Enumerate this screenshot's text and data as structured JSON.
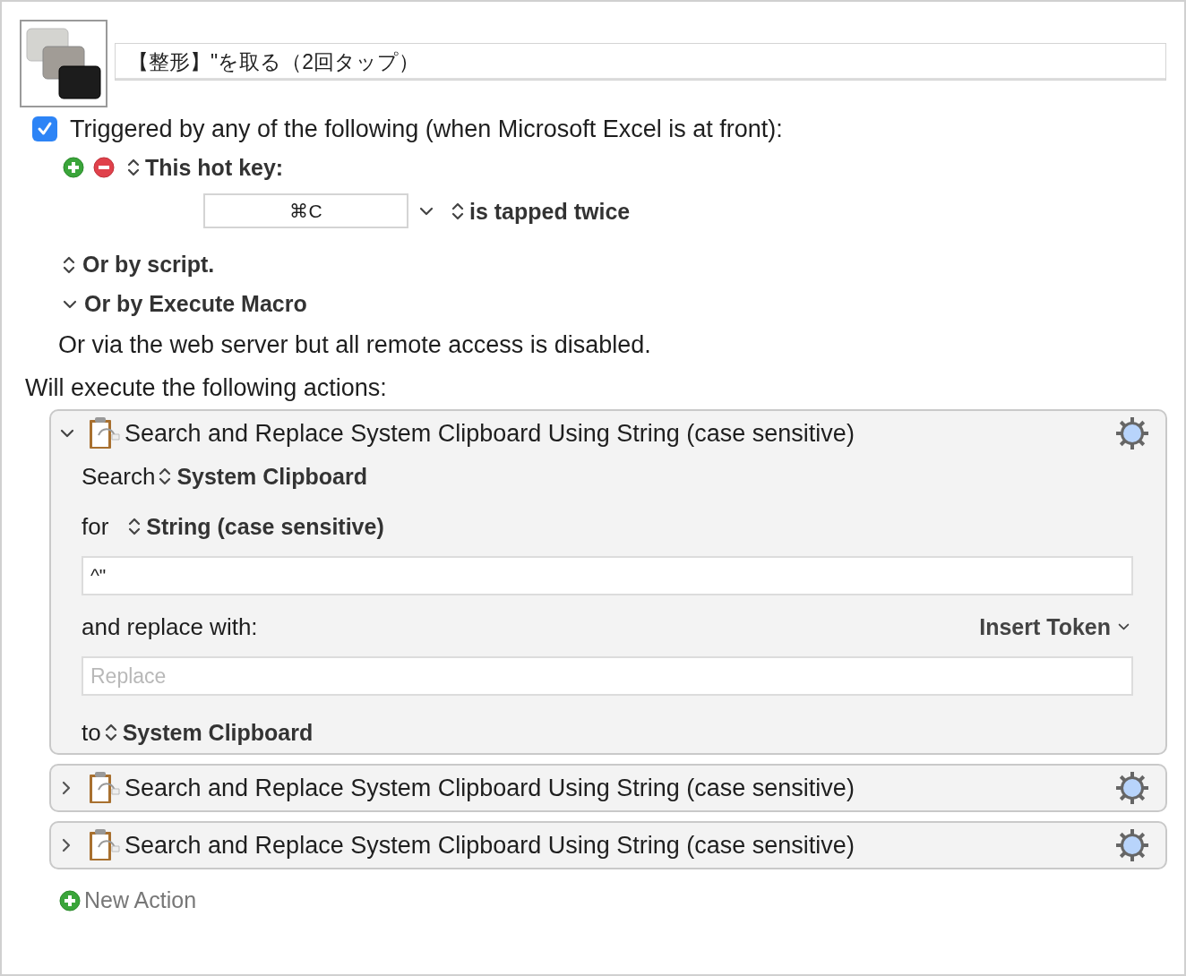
{
  "macro": {
    "name": "【整形】\"を取る（2回タップ）"
  },
  "trigger": {
    "checked": true,
    "label": "Triggered by any of the following (when Microsoft Excel is at front):"
  },
  "hot_key": {
    "label": "This hot key:",
    "key": "⌘C",
    "mode": "is tapped twice"
  },
  "trigger_options": [
    {
      "kind": "popup",
      "label": "Or by script."
    },
    {
      "kind": "disclosure",
      "label": "Or by Execute Macro"
    }
  ],
  "web_server_note": "Or via the web server but all remote access is disabled.",
  "actions_heading": "Will execute the following actions:",
  "actions": [
    {
      "title": "Search and Replace System Clipboard Using String (case sensitive)",
      "expanded": true,
      "search_label": "Search",
      "search_source": "System Clipboard",
      "for_label": "for",
      "match_type": "String (case sensitive)",
      "search_value": "^\"",
      "replace_label": "and replace with:",
      "insert_token": "Insert Token",
      "replace_placeholder": "Replace",
      "to_label": "to",
      "destination": "System Clipboard"
    },
    {
      "title": "Search and Replace System Clipboard Using String (case sensitive)",
      "expanded": false
    },
    {
      "title": "Search and Replace System Clipboard Using String (case sensitive)",
      "expanded": false
    }
  ],
  "new_action": "New Action"
}
